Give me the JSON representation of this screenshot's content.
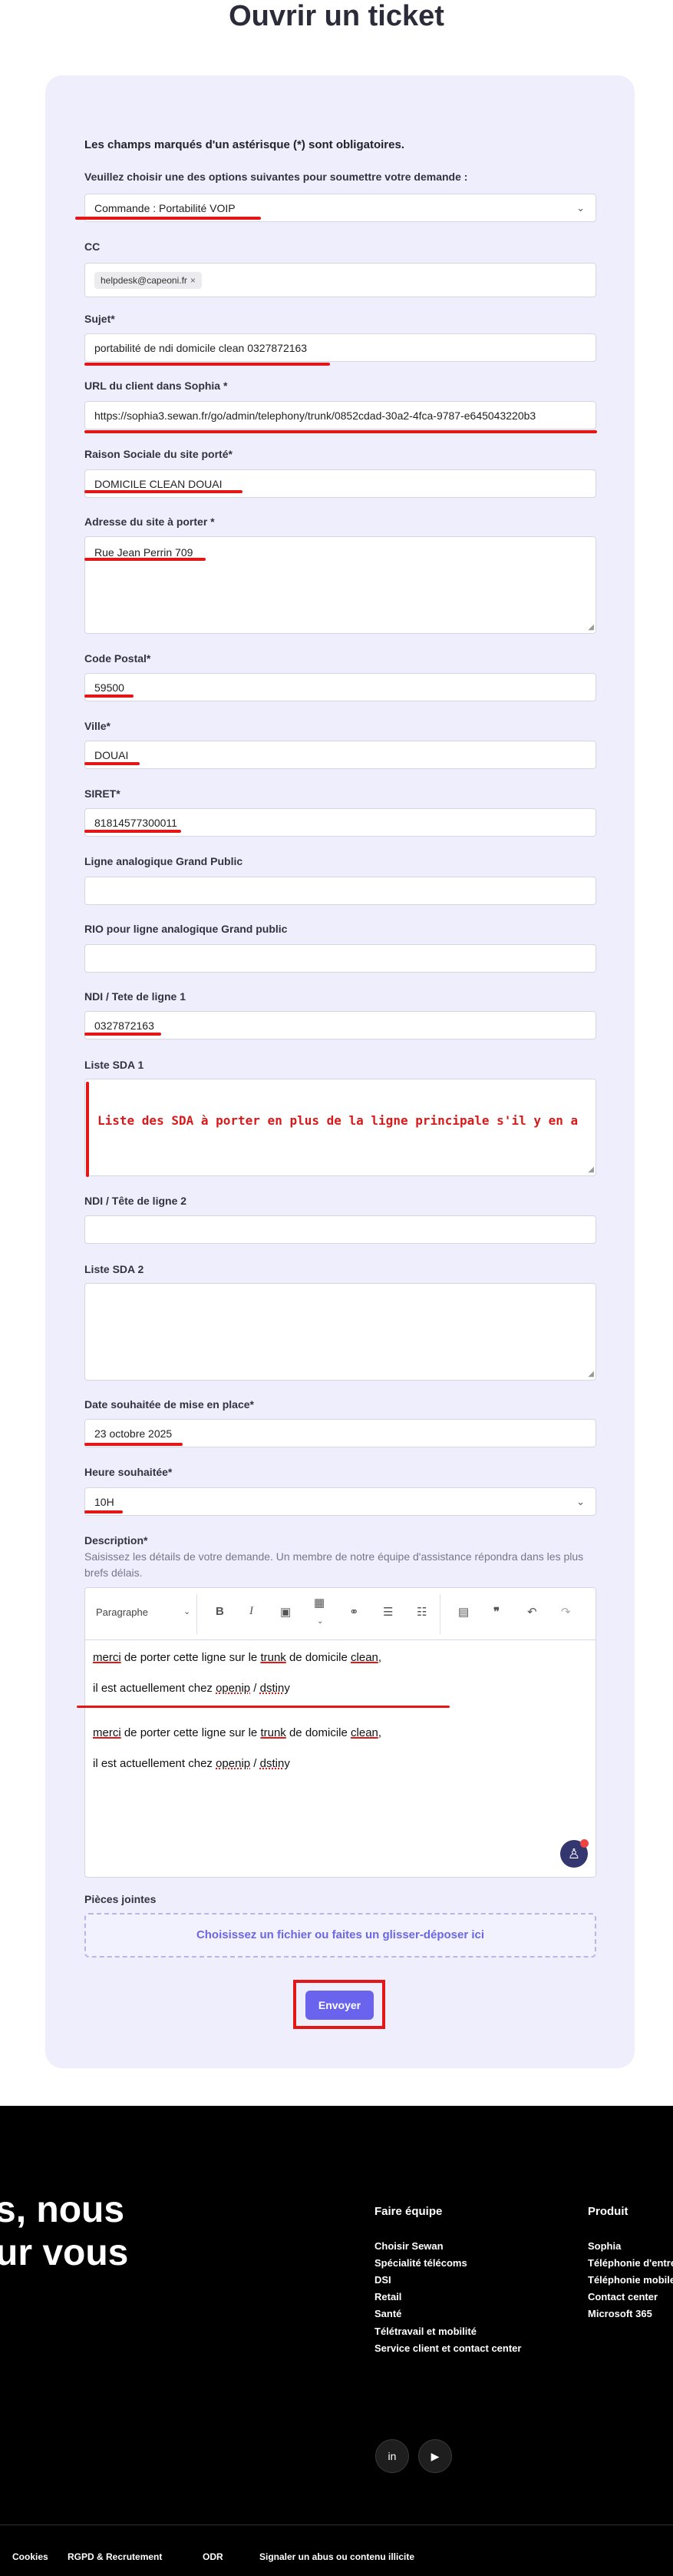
{
  "page": {
    "title": "Ouvrir un ticket"
  },
  "form": {
    "required_note": "Les champs marqués d'un astérisque (*) sont obligatoires.",
    "request_type": {
      "label": "Veuillez choisir une des options suivantes pour soumettre votre demande :",
      "value": "Commande : Portabilité VOIP"
    },
    "cc": {
      "label": "CC",
      "chip": "helpdesk@capeoni.fr",
      "chip_remove": "×"
    },
    "subject": {
      "label": "Sujet*",
      "value": "portabilité de ndi domicile clean 0327872163"
    },
    "sophia_url": {
      "label": "URL du client dans Sophia *",
      "value": "https://sophia3.sewan.fr/go/admin/telephony/trunk/0852cdad-30a2-4fca-9787-e645043220b3"
    },
    "company": {
      "label": "Raison Sociale du site porté*",
      "value": "DOMICILE CLEAN DOUAI"
    },
    "address": {
      "label": "Adresse du site à porter *",
      "value": "Rue Jean Perrin 709"
    },
    "postal_code": {
      "label": "Code Postal*",
      "value": "59500"
    },
    "city": {
      "label": "Ville*",
      "value": "DOUAI"
    },
    "siret": {
      "label": "SIRET*",
      "value": "81814577300011"
    },
    "analog_line": {
      "label": "Ligne analogique Grand Public",
      "value": ""
    },
    "rio": {
      "label": "RIO pour ligne analogique Grand public",
      "value": ""
    },
    "ndi1": {
      "label": "NDI / Tete de ligne 1",
      "value": "0327872163"
    },
    "sda1": {
      "label": "Liste SDA 1",
      "value": "Liste des SDA à porter en plus de la ligne principale s'il y en a"
    },
    "ndi2": {
      "label": "NDI / Tête de ligne 2",
      "value": ""
    },
    "sda2": {
      "label": "Liste SDA 2",
      "value": ""
    },
    "date": {
      "label": "Date souhaitée de mise en place*",
      "value": "23 octobre 2025"
    },
    "time": {
      "label": "Heure souhaitée*",
      "value": "10H"
    },
    "description": {
      "label": "Description*",
      "hint": "Saisissez les détails de votre demande. Un membre de notre équipe d'assistance répondra dans les plus brefs délais.",
      "toolbar": {
        "paragraph": "Paragraphe",
        "bold": "B",
        "italic": "I"
      },
      "lines": [
        [
          "merci",
          " de porter cette ligne sur le ",
          "trunk",
          " de domicile ",
          "clean",
          ","
        ],
        [
          "il est actuellement chez ",
          "openip",
          " / ",
          "dstiny",
          ""
        ],
        [
          "merci",
          " de porter cette ligne sur le ",
          "trunk",
          " de domicile ",
          "clean",
          ","
        ],
        [
          "il est actuellement chez ",
          "openip",
          " / ",
          "dstiny",
          ""
        ]
      ]
    },
    "attachments": {
      "label": "Pièces jointes",
      "dropzone": "Choisissez un fichier ou faites un glisser-déposer ici"
    },
    "submit_label": "Envoyer"
  },
  "footer": {
    "tagline_1": "s, nous",
    "tagline_2": "ur vous",
    "col1": {
      "heading": "Faire équipe",
      "links": [
        "Choisir Sewan",
        "Spécialité télécoms",
        "DSI",
        "Retail",
        "Santé",
        "Télétravail et mobilité",
        "Service client et contact center"
      ]
    },
    "col2": {
      "heading": "Produit",
      "links": [
        "Sophia",
        "Téléphonie d'entrep",
        "Téléphonie mobile",
        "Contact center",
        "Microsoft 365"
      ]
    },
    "social": [
      "in",
      "▶"
    ],
    "bottom_links": [
      "Cookies",
      "RGPD & Recrutement",
      "ODR",
      "Signaler un abus ou contenu illicite"
    ]
  },
  "colors": {
    "accent": "#6a63ee",
    "card_bg": "#efeefd",
    "annotation_red": "#e41616"
  }
}
